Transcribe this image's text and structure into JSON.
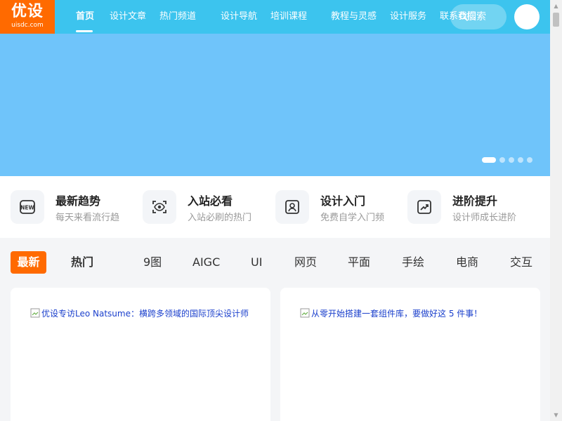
{
  "logo": {
    "main": "优设",
    "sub": "uisdc.com"
  },
  "nav": [
    {
      "label": "首页",
      "active": true
    },
    {
      "label": "设计文章"
    },
    {
      "label": "热门频道"
    },
    {
      "label": "设计导航"
    },
    {
      "label": "培训课程"
    },
    {
      "label": "教程与灵感"
    },
    {
      "label": "设计服务"
    },
    {
      "label": "联系我们"
    }
  ],
  "search": {
    "label": "搜索"
  },
  "quick_links": [
    {
      "title": "最新趋势",
      "sub": "每天来看流行趋",
      "icon": "new-badge-icon"
    },
    {
      "title": "入站必看",
      "sub": "入站必刷的热门",
      "icon": "eye-scan-icon"
    },
    {
      "title": "设计入门",
      "sub": "免费自学入门频",
      "icon": "user-card-icon"
    },
    {
      "title": "进阶提升",
      "sub": "设计师成长进阶",
      "icon": "trend-up-icon"
    }
  ],
  "tabs": [
    "最新",
    "热门",
    "9图",
    "AIGC",
    "UI",
    "网页",
    "平面",
    "手绘",
    "电商",
    "交互"
  ],
  "cards": [
    {
      "alt": "优设专访Leo Natsume：横跨多领域的国际顶尖设计师"
    },
    {
      "alt": "从零开始搭建一套组件库，要做好这 5 件事！"
    }
  ],
  "colors": {
    "header": "#3cc4ee",
    "brand": "#ff6a00",
    "banner": "#6fc4fa"
  }
}
